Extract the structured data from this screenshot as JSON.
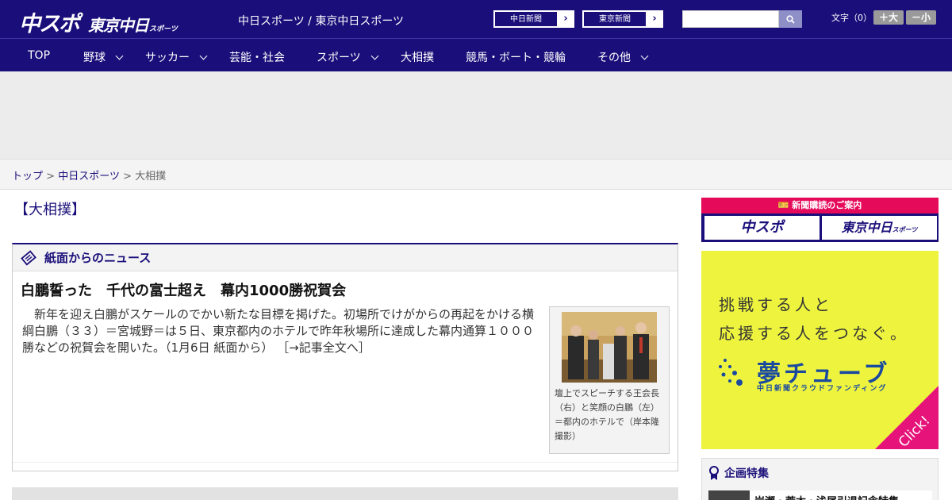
{
  "header": {
    "logo_main": "中スポ",
    "logo_sub": "東京中日",
    "logo_small": "スポーツ",
    "tagline": "中日スポーツ / 東京中日スポーツ",
    "newspaper_links": [
      {
        "label": "中日新聞",
        "arrow": "›"
      },
      {
        "label": "東京新聞",
        "arrow": "›"
      }
    ],
    "search": {
      "value": "",
      "placeholder": ""
    },
    "font_size_label": "文字（0）",
    "font_larger": "＋大",
    "font_smaller": "－小"
  },
  "nav": {
    "items": [
      {
        "label": "TOP",
        "has_menu": false
      },
      {
        "label": "野球",
        "has_menu": true
      },
      {
        "label": "サッカー",
        "has_menu": true
      },
      {
        "label": "芸能・社会",
        "has_menu": false
      },
      {
        "label": "スポーツ",
        "has_menu": true
      },
      {
        "label": "大相撲",
        "has_menu": false
      },
      {
        "label": "競馬・ボート・競輪",
        "has_menu": false
      },
      {
        "label": "その他",
        "has_menu": true
      }
    ]
  },
  "breadcrumb": {
    "items": [
      "トップ",
      "中日スポーツ",
      "大相撲"
    ],
    "separator": ">"
  },
  "page": {
    "title": "【大相撲】"
  },
  "news": {
    "section_title": "紙面からのニュース",
    "headline": "白鵬誓った　千代の富士超え　幕内1000勝祝賀会",
    "body": "新年を迎え白鵬がスケールのでかい新たな目標を掲げた。初場所でけがからの再起をかける横綱白鵬（３３）＝宮城野＝は５日、東京都内のホテルで昨年秋場所に達成した幕内通算１０００勝などの祝賀会を開いた。（1月6日 紙面から）",
    "more_link": "［→記事全文へ］",
    "photo_caption": "壇上でスピーチする王会長（右）と笑顔の白鵬（左）＝都内のホテルで（岸本隆撮影）"
  },
  "sidebar": {
    "subscription_title": "新聞購読のご案内",
    "subscription_buttons": [
      {
        "label": "中スポ"
      },
      {
        "label": "東京中日",
        "small": "スポーツ"
      }
    ],
    "ad": {
      "line1": "挑戦する人と",
      "line2": "応援する人をつなぐ。",
      "brand": "夢チューブ",
      "brand_sub": "中日新聞クラウドファンディング",
      "click": "Click!"
    },
    "features_title": "企画特集",
    "features_first": "岩瀬・荒木・浅尾引退記念特集"
  },
  "colors": {
    "brand_navy": "#1a0f7a",
    "accent_pink": "#e60a5a",
    "ad_yellow": "#eef43e",
    "ad_blue": "#1a4a9f"
  }
}
